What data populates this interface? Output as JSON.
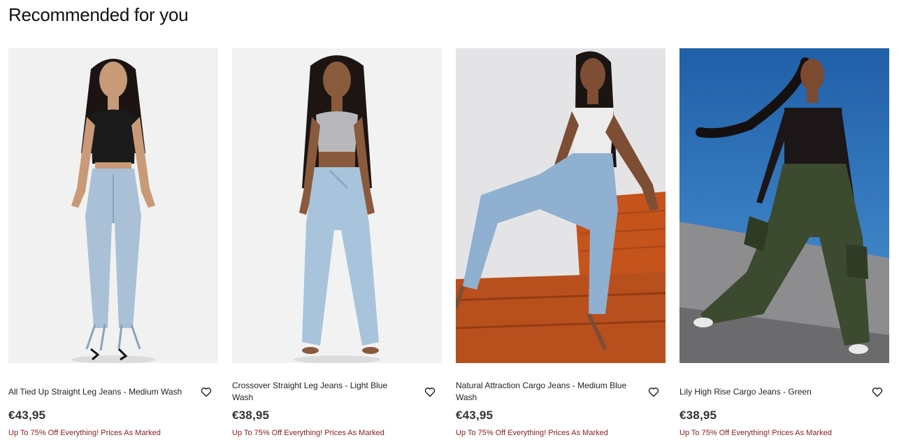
{
  "section": {
    "title": "Recommended for you"
  },
  "products": [
    {
      "name": "All Tied Up Straight Leg Jeans - Medium Wash",
      "price": "€43,95",
      "promo": "Up To 75% Off Everything! Prices As Marked"
    },
    {
      "name": "Crossover Straight Leg Jeans - Light Blue Wash",
      "price": "€38,95",
      "promo": "Up To 75% Off Everything! Prices As Marked"
    },
    {
      "name": "Natural Attraction Cargo Jeans - Medium Blue Wash",
      "price": "€43,95",
      "promo": "Up To 75% Off Everything! Prices As Marked"
    },
    {
      "name": "Lily High Rise Cargo Jeans - Green",
      "price": "€38,95",
      "promo": "Up To 75% Off Everything! Prices As Marked"
    }
  ],
  "icons": {
    "wishlist": "heart-outline-icon"
  },
  "colors": {
    "promo": "#8b1a1a",
    "price": "#333333"
  }
}
